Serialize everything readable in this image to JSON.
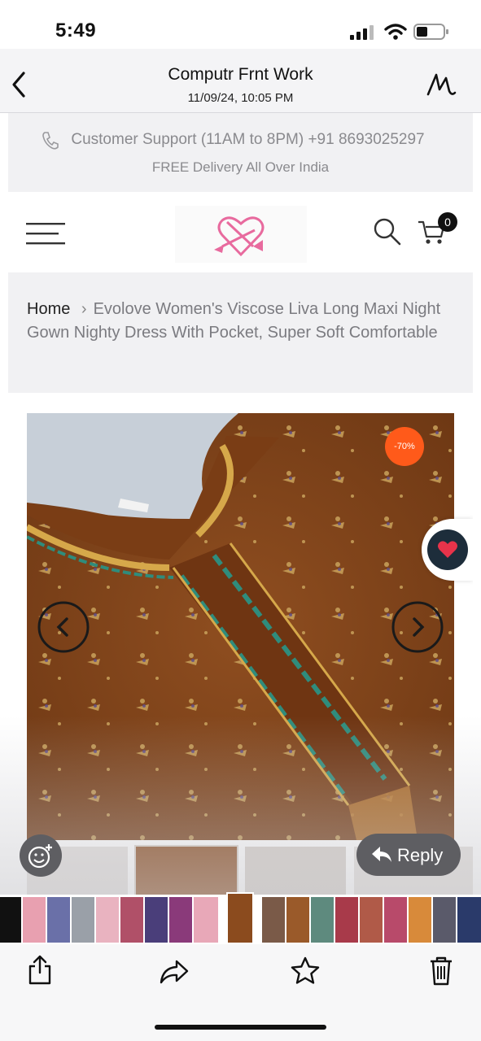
{
  "status_bar": {
    "time": "5:49",
    "cart_count": "0"
  },
  "header": {
    "title": "Computr Frnt Work",
    "subtitle": "11/09/24, 10:05 PM",
    "icons": [
      "chevron-left-icon",
      "markup-icon"
    ]
  },
  "web": {
    "support_text": "Customer Support (11AM to 8PM) +91 8693025297",
    "delivery_text": "FREE Delivery All Over India",
    "cart_badge": "0",
    "breadcrumb": {
      "home": "Home",
      "separator": "›",
      "current": "Evolove Women's Viscose Liva Long Maxi Night Gown Nighty Dress With Pocket, Super Soft Comfortable"
    },
    "discount_badge": "-70%"
  },
  "reply": {
    "label": "Reply"
  },
  "colors": {
    "accent_pink": "#e86a9e",
    "discount": "#ff5a1a",
    "fabric": "#8b4b1e",
    "wishlist": "#1d2d3b",
    "heart": "#e8334a"
  },
  "toolbar": {
    "icons": [
      "share-icon",
      "forward-icon",
      "star-icon",
      "trash-icon"
    ]
  }
}
